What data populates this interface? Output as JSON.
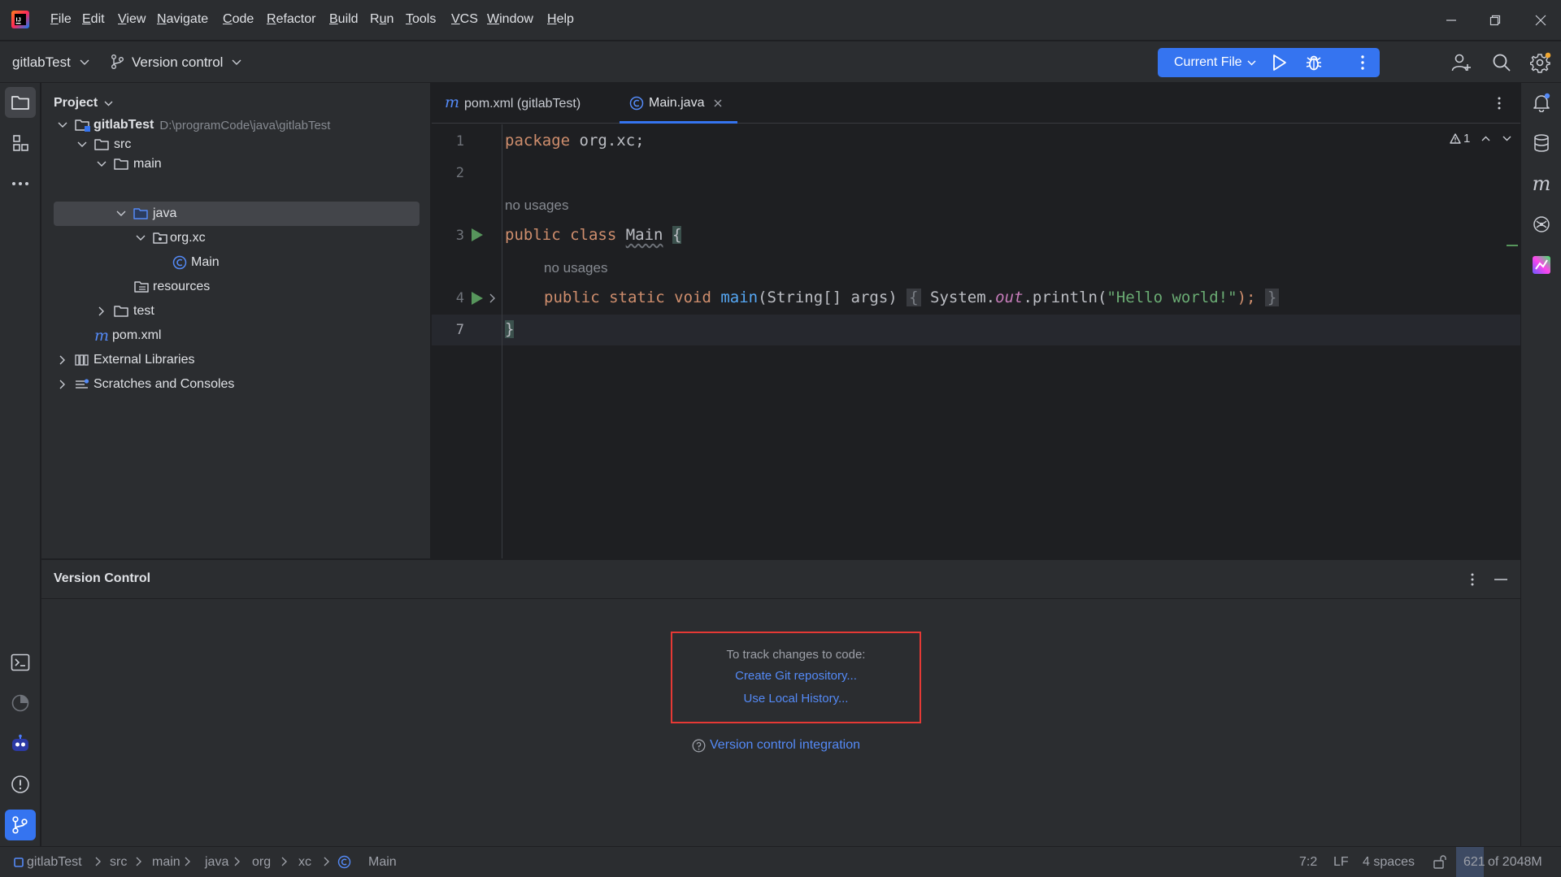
{
  "menubar": {
    "items": [
      {
        "label": "File",
        "mnemonic_index": 0
      },
      {
        "label": "Edit",
        "mnemonic_index": 0
      },
      {
        "label": "View",
        "mnemonic_index": 0
      },
      {
        "label": "Navigate",
        "mnemonic_index": 0
      },
      {
        "label": "Code",
        "mnemonic_index": 0
      },
      {
        "label": "Refactor",
        "mnemonic_index": 0
      },
      {
        "label": "Build",
        "mnemonic_index": 0
      },
      {
        "label": "Run",
        "mnemonic_index": 1
      },
      {
        "label": "Tools",
        "mnemonic_index": 0
      },
      {
        "label": "VCS",
        "mnemonic_index": 0
      },
      {
        "label": "Window",
        "mnemonic_index": 0
      },
      {
        "label": "Help",
        "mnemonic_index": 0
      }
    ]
  },
  "toolbar": {
    "project_name": "gitlabTest",
    "vcs_label": "Version control",
    "run_config": "Current File"
  },
  "project_panel": {
    "title": "Project",
    "tree": {
      "root": "gitlabTest",
      "root_path": "D:\\programCode\\java\\gitlabTest",
      "src": "src",
      "main": "main",
      "java": "java",
      "package": "org.xc",
      "class": "Main",
      "resources": "resources",
      "test": "test",
      "pom": "pom.xml",
      "external": "External Libraries",
      "scratches": "Scratches and Consoles"
    }
  },
  "editor": {
    "tabs": [
      {
        "label": "pom.xml (gitlabTest)",
        "active": false
      },
      {
        "label": "Main.java",
        "active": true
      }
    ],
    "warnings_count": "1",
    "line_numbers": [
      "1",
      "2",
      "3",
      "4",
      "7"
    ],
    "hints": {
      "no_usages_1": "no usages",
      "no_usages_2": "no usages"
    },
    "code": {
      "l1_kw": "package",
      "l1_rest": " org.xc;",
      "l3_kw": "public class ",
      "l3_name": "Main",
      "l3_brace": "{",
      "l4_kw": "public static void ",
      "l4_fn": "main",
      "l4_params": "(String[] args)",
      "l4_fold_open": "{",
      "l4_sys": " System.",
      "l4_out": "out",
      "l4_println": ".println(",
      "l4_str": "\"Hello world!\"",
      "l4_end": ");",
      "l4_fold_close": "}",
      "l7_brace": "}"
    }
  },
  "vc_panel": {
    "title": "Version Control",
    "track_text": "To track changes to code:",
    "create_git": "Create Git repository...",
    "local_history": "Use Local History...",
    "integration": "Version control integration"
  },
  "statusbar": {
    "breadcrumbs": [
      "gitlabTest",
      "src",
      "main",
      "java",
      "org",
      "xc",
      "Main"
    ],
    "position": "7:2",
    "line_ending": "LF",
    "indent": "4 spaces",
    "memory_used": "621",
    "memory_total": "of 2048M"
  },
  "colors": {
    "accent": "#3574f0",
    "link": "#548af7",
    "highlight_box": "#e53935"
  }
}
